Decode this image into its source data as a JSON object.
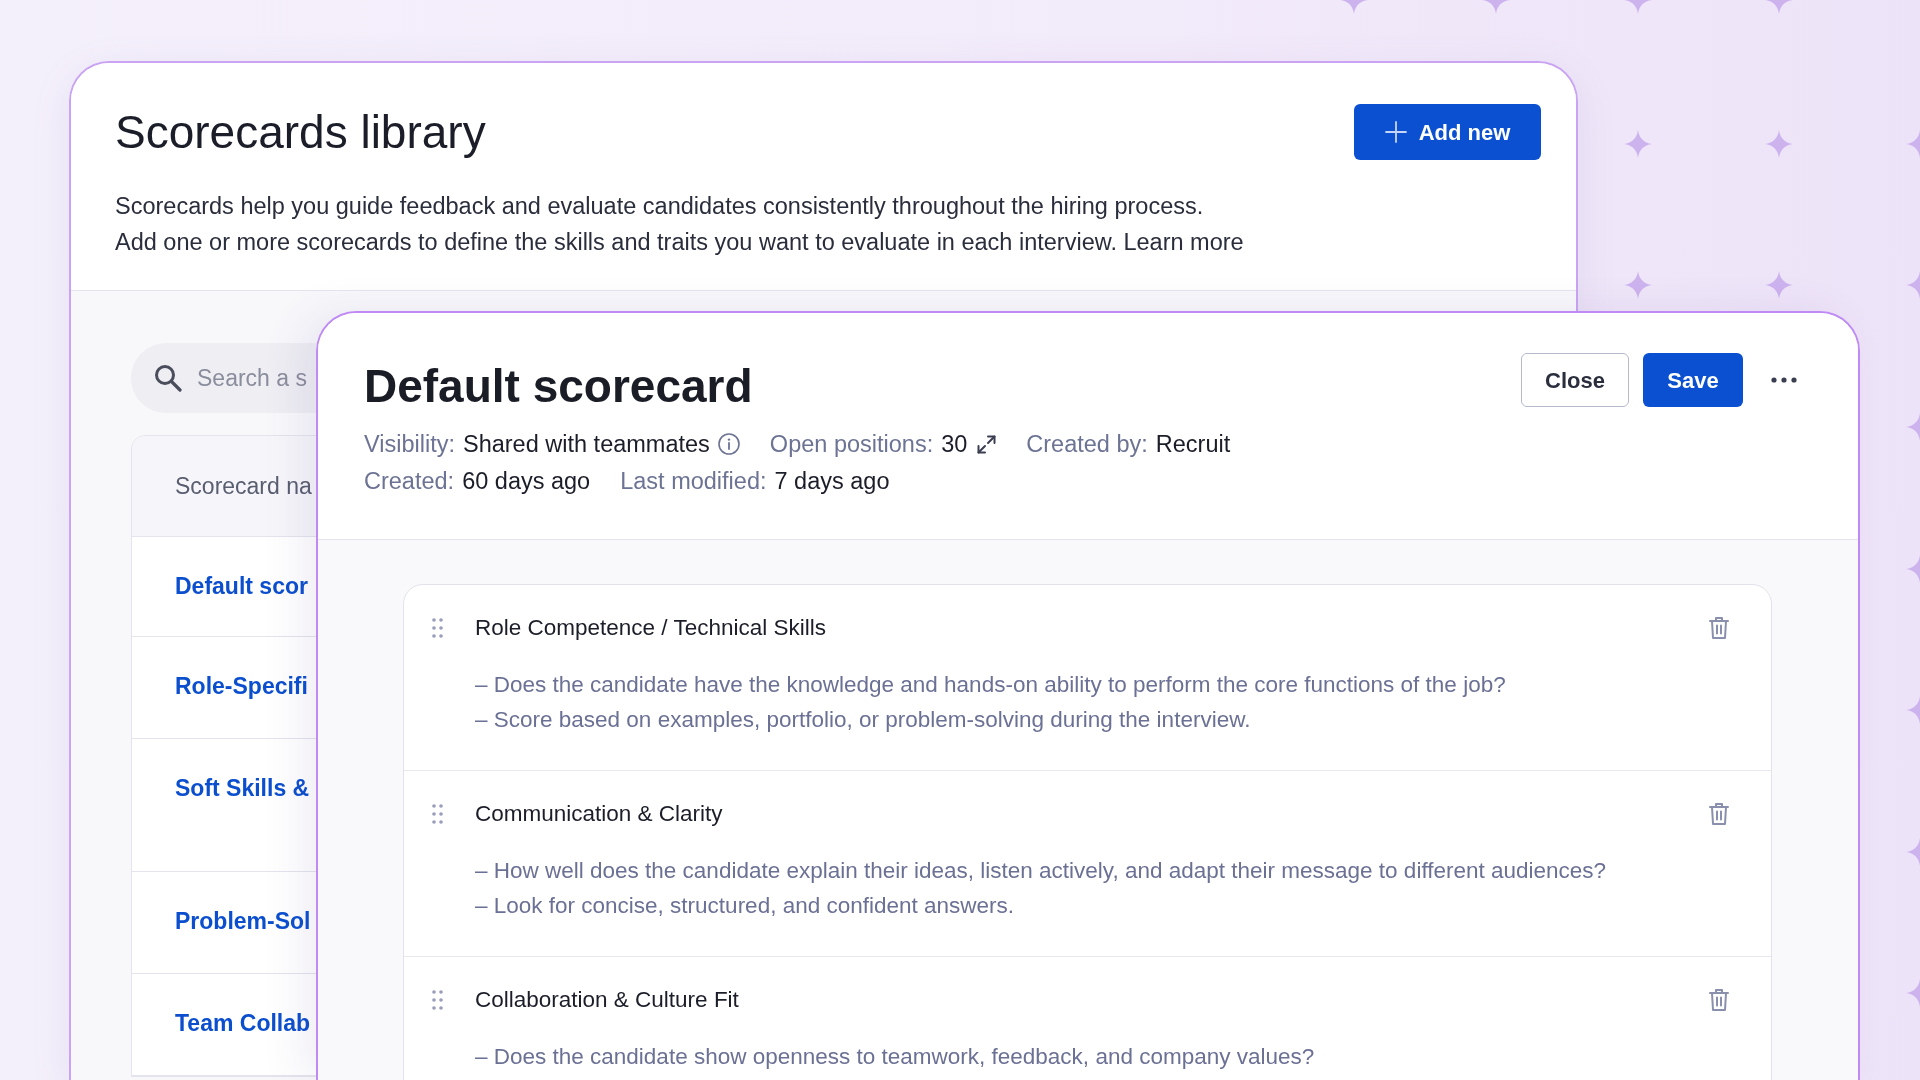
{
  "library": {
    "title": "Scorecards library",
    "add_button": {
      "label": "Add new"
    },
    "description": [
      "Scorecards help you guide feedback and evaluate candidates consistently throughout the hiring process.",
      "Add one or more scorecards to define the skills and traits you want to evaluate in each interview. Learn more"
    ],
    "search": {
      "placeholder": "Search a s"
    },
    "table": {
      "columns": [
        "Scorecard na"
      ],
      "rows": [
        [
          "Default scor"
        ],
        [
          "Role-Specifi"
        ],
        [
          "Soft Skills &"
        ],
        [
          "Problem-Sol"
        ],
        [
          "Team Collab"
        ]
      ]
    }
  },
  "scorecard": {
    "title": "Default scorecard",
    "buttons": [
      {
        "label": "Close",
        "kind": "secondary"
      },
      {
        "label": "Save",
        "kind": "primary"
      }
    ],
    "meta_rows": [
      [
        {
          "label": "Visibility:",
          "value": "Shared with teammates",
          "kind": "info"
        },
        {
          "label": "Open positions:",
          "value": "30",
          "kind": "expandable"
        },
        {
          "label": "Created by:",
          "value": "Recruit",
          "kind": "text"
        }
      ],
      [
        {
          "label": "Created:",
          "value": "60 days ago",
          "kind": "text"
        },
        {
          "label": "Last modified:",
          "value": "7 days ago",
          "kind": "text"
        }
      ]
    ],
    "criteria": [
      {
        "title": "Role Competence / Technical Skills",
        "points": [
          "– Does the candidate have the knowledge and hands-on ability to perform the core functions of the job?",
          "– Score based on examples, portfolio, or problem-solving during the interview."
        ]
      },
      {
        "title": "Communication & Clarity",
        "points": [
          "– How well does the candidate explain their ideas, listen actively, and adapt their message to different audiences?",
          "– Look for concise, structured, and confident answers."
        ]
      },
      {
        "title": "Collaboration & Culture Fit",
        "points": [
          "– Does the candidate show openness to teamwork, feedback, and company values?"
        ]
      }
    ]
  }
}
